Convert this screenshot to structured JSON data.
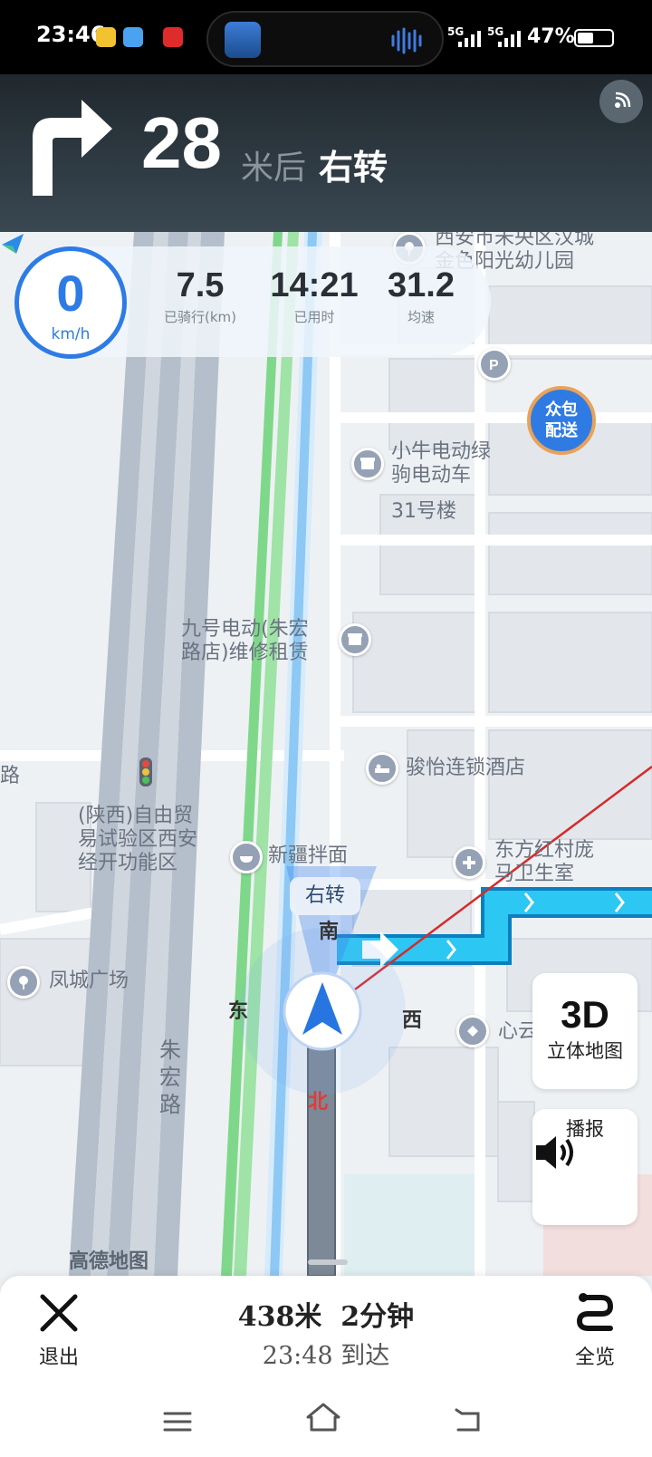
{
  "status_bar": {
    "time": "23:46",
    "network_1": "5G",
    "network_2": "5G",
    "battery_percent": "47%",
    "battery_level": 0.47
  },
  "navigation": {
    "distance": "28",
    "unit": "米后",
    "action": "右转",
    "turn_icon": "turn-right-icon"
  },
  "speed_panel": {
    "speed": "0",
    "speed_unit": "km/h",
    "stats": [
      {
        "value": "7.5",
        "label": "已骑行(km)"
      },
      {
        "value": "14:21",
        "label": "已用时"
      },
      {
        "value": "31.2",
        "label": "均速"
      }
    ]
  },
  "map": {
    "labels": {
      "kindergarten": "西安市未央区汉城\n金色阳光幼儿园",
      "ev_shop": "小牛电动绿\n驹电动车",
      "building31": "31号楼",
      "ninebot": "九号电动(朱宏\n路店)维修租赁",
      "hotel": "骏怡连锁酒店",
      "road_left": "路",
      "ftz": "(陕西)自由贸\n易试验区西安\n经开功能区",
      "noodle": "新疆拌面",
      "clinic": "东方红村庞\n马卫生室",
      "plaza": "凤城广场",
      "shop": "心云",
      "road_zhuhong": "朱\n宏\n路"
    },
    "zhongbao": "众包\n配送",
    "turn_bubble": "右转",
    "compass": {
      "south": "南",
      "east": "东",
      "west": "西",
      "north": "北"
    },
    "logo_text": "高德地图"
  },
  "side_buttons": {
    "view_3d_big": "3D",
    "view_3d_label": "立体地图",
    "broadcast_label": "播报"
  },
  "bottom_bar": {
    "exit_label": "退出",
    "trip_summary": "438米  2分钟",
    "eta": "23:48 到达",
    "overview_label": "全览"
  },
  "colors": {
    "accent": "#2d7be6",
    "route": "#29b6f6",
    "header_dark": "#20282e"
  }
}
